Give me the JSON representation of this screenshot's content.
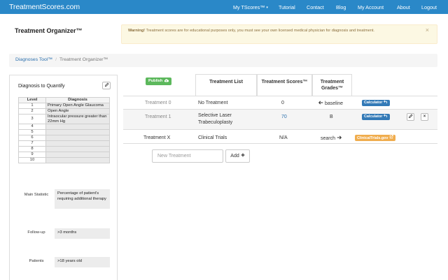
{
  "navbar": {
    "brand": "TreatmentScores.com",
    "links": [
      {
        "label": "My TScores™",
        "caret": "▾"
      },
      {
        "label": "Tutorial"
      },
      {
        "label": "Contact"
      },
      {
        "label": "Blog"
      },
      {
        "label": "My Account"
      },
      {
        "label": "About"
      },
      {
        "label": "Logout"
      }
    ]
  },
  "page": {
    "title": "Treatment Organizer™"
  },
  "alert": {
    "strong": "Warning!",
    "text": " Treatment scores are for educational purposes only, you must see your own licensed medical physician for diagnosis and treatment.",
    "close": "×"
  },
  "breadcrumb": {
    "link": "Diagnoses Tool™",
    "separator": "/",
    "current": "Treatment Organizer™"
  },
  "diagnosis_panel": {
    "title": "Diagnosis to Quantify",
    "edit_icon": "pencil-icon",
    "table": {
      "headers": [
        "Level",
        "Diagnosis"
      ],
      "rows": [
        {
          "level": "1",
          "diagnosis": "Primary Open Angle Glaucoma"
        },
        {
          "level": "2",
          "diagnosis": "Open Angle"
        },
        {
          "level": "3",
          "diagnosis": "Intraocular pressure greater than 22mm Hg"
        },
        {
          "level": "4",
          "diagnosis": ""
        },
        {
          "level": "5",
          "diagnosis": ""
        },
        {
          "level": "6",
          "diagnosis": ""
        },
        {
          "level": "7",
          "diagnosis": ""
        },
        {
          "level": "8",
          "diagnosis": ""
        },
        {
          "level": "9",
          "diagnosis": ""
        },
        {
          "level": "10",
          "diagnosis": ""
        }
      ]
    },
    "main_statistic": {
      "label": "Main Statistic",
      "value": "Percentage of patient's requiring additional therapy"
    },
    "follow_up": {
      "label": "Follow-up",
      "value": ">3 months"
    },
    "patients": {
      "label": "Patients",
      "value": ">18 years old"
    }
  },
  "treatments": {
    "publish_label": "Publish",
    "publish_icon": "cloud-upload-icon",
    "headers": {
      "list": "Treatment List",
      "scores": "Treatment Scores™",
      "grades": "Treatment Grades™"
    },
    "rows": [
      {
        "name": "Treatment 0",
        "treatment": "No Treatment",
        "score": "0",
        "grade": "baseline",
        "grade_icon": "arrow-left-icon",
        "action": "Calculator",
        "action_icon": "undo-icon"
      },
      {
        "name": "Treatment 1",
        "treatment": "Selective Laser Trabeculoplasty",
        "score": "70",
        "grade": "B",
        "action": "Calculator",
        "action_icon": "undo-icon",
        "edit_icon": "pencil-icon",
        "delete_icon": "close-icon",
        "delete_glyph": "×"
      },
      {
        "name": "Treatment X",
        "treatment": "Clinical Trials",
        "score": "N/A",
        "grade": "search",
        "grade_icon": "arrow-right-icon",
        "action": "ClinicalTrials.gov",
        "action_icon": "external-link-icon"
      }
    ],
    "new_placeholder": "New Treatment",
    "add_label": "Add",
    "add_icon": "plus-icon"
  },
  "colors": {
    "navbar": "#2a88c8",
    "publish": "#5cb85c",
    "calculator": "#337ab7",
    "clinical_trials": "#f0ad4e",
    "alert_bg": "#fcf8e3",
    "alert_text": "#8a6d3b",
    "link": "#2a6fad"
  }
}
